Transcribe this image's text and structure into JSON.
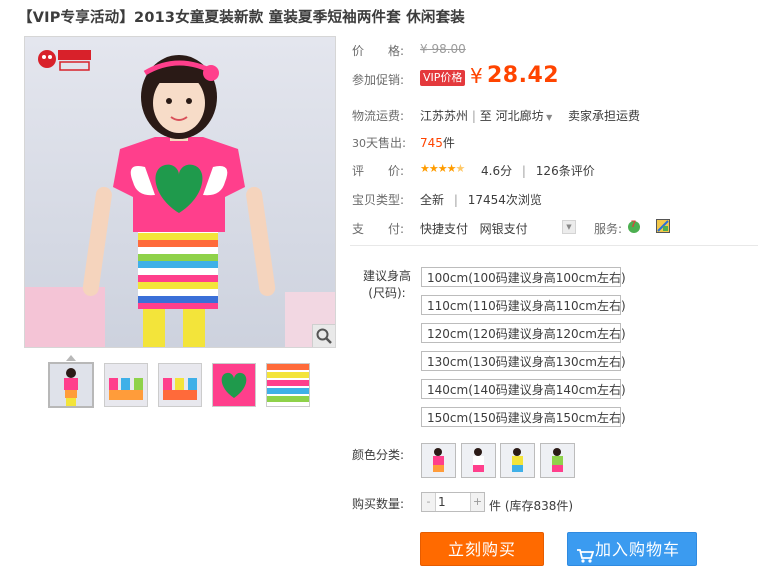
{
  "product": {
    "title": "【VIP专享活动】2013女童夏装新款 童装夏季短袖两件套 休闲套装",
    "brand_logo_text": "可爱美 CEAH"
  },
  "price": {
    "label": "价　　格:",
    "original": "¥ 98.00"
  },
  "promo": {
    "label": "参加促销:",
    "badge": "VIP价格",
    "currency": "¥",
    "price": "28.42"
  },
  "shipping": {
    "label": "物流运费:",
    "from": "江苏苏州",
    "sep": "|",
    "to_prefix": "至",
    "to": "河北廊坊",
    "fee": "卖家承担运费"
  },
  "sales": {
    "label_prefix": "30",
    "label": "天售出:",
    "count": "745",
    "unit": "件"
  },
  "rating": {
    "label": "评　　价:",
    "stars": 4.6,
    "score": "4.6分",
    "sep": "|",
    "reviews": "126条评价"
  },
  "item_type": {
    "label": "宝贝类型:",
    "value": "全新",
    "sep": "|",
    "views": "17454次浏览"
  },
  "payment": {
    "label": "支　　付:",
    "methods": [
      "快捷支付",
      "网银支付"
    ],
    "service_label": "服务:"
  },
  "sizes": {
    "label_line1": "建议身高",
    "label_line2": "(尺码):",
    "options": [
      "100cm(100码建议身高100cm左右)",
      "110cm(110码建议身高110cm左右)",
      "120cm(120码建议身高120cm左右)",
      "130cm(130码建议身高130cm左右)",
      "140cm(140码建议身高140cm左右)",
      "150cm(150码建议身高150cm左右)"
    ]
  },
  "colors": {
    "label": "颜色分类:"
  },
  "quantity": {
    "label": "购买数量:",
    "minus": "-",
    "value": "1",
    "plus": "+",
    "stock": "件 (库存838件)"
  },
  "actions": {
    "buy_now": "立刻购买",
    "add_to_cart": "加入购物车"
  },
  "theme": {
    "accent_orange": "#ff4400",
    "buy_button": "#ff6a00",
    "cart_button": "#3b9bf0",
    "promo_badge": "#e4393c",
    "star": "#ff9c00"
  },
  "icons": [
    "zoom-icon",
    "chevron-down-icon",
    "service-7day-icon",
    "service-badge-icon",
    "cart-icon",
    "brand-logo-icon"
  ]
}
